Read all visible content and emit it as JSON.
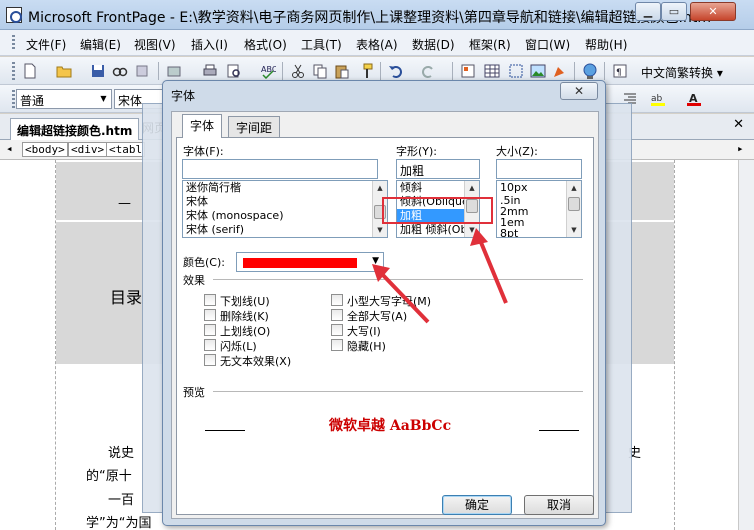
{
  "window": {
    "title": "Microsoft FrontPage - E:\\教学资料\\电子商务网页制作\\上课整理资料\\第四章导航和链接\\编辑超链接颜色.htm",
    "min_label": "▁",
    "max_label": "▭",
    "close_label": "✕"
  },
  "menu": [
    {
      "label": "文件(F)"
    },
    {
      "label": "编辑(E)"
    },
    {
      "label": "视图(V)"
    },
    {
      "label": "插入(I)"
    },
    {
      "label": "格式(O)"
    },
    {
      "label": "工具(T)"
    },
    {
      "label": "表格(A)"
    },
    {
      "label": "数据(D)"
    },
    {
      "label": "框架(R)"
    },
    {
      "label": "窗口(W)"
    },
    {
      "label": "帮助(H)"
    }
  ],
  "toolbar": {
    "convert_label": "中文简繁转换 ▾",
    "style_value": "普通",
    "font_value": "宋体"
  },
  "doc_tabs": {
    "active": "编辑超链接颜色.htm",
    "second": "网页",
    "close": "✕"
  },
  "tags": [
    "<body>",
    "<div>",
    "<tabl"
  ],
  "editor": {
    "toc": "目录",
    "dash": "—",
    "p1a": "说史",
    "p1b": "史",
    "p2": "的“原十",
    "p3": "一百",
    "p4": "学”为“为国"
  },
  "dialog": {
    "title": "字体",
    "close_label": "✕",
    "tabs": [
      {
        "label": "字体"
      },
      {
        "label": "字间距"
      }
    ],
    "font_label": "字体(F):",
    "font_value": "",
    "font_list": [
      "迷你简行楷",
      "宋体",
      "宋体 (monospace)",
      "宋体 (serif)"
    ],
    "style_label": "字形(Y):",
    "style_value": "加粗",
    "style_list": [
      "倾斜",
      "倾斜(Oblique)",
      "加粗",
      "加粗 倾斜(Oblique)"
    ],
    "size_label": "大小(Z):",
    "size_value": "",
    "size_list": [
      "10px",
      ".5in",
      "2mm",
      "1em",
      "8pt"
    ],
    "color_label": "颜色(C):",
    "color_value": "#ff0000",
    "effects_label": "效果",
    "effects_left": [
      "下划线(U)",
      "删除线(K)",
      "上划线(O)",
      "闪烁(L)",
      "无文本效果(X)"
    ],
    "effects_right": [
      "小型大写字母(M)",
      "全部大写(A)",
      "大写(I)",
      "隐藏(H)"
    ],
    "preview_label": "预览",
    "preview_text": "微软卓越 AaBbCc",
    "preview_color": "#cc0000",
    "ok_label": "确定",
    "cancel_label": "取消"
  },
  "annotation": {
    "color": "#e0303a"
  }
}
